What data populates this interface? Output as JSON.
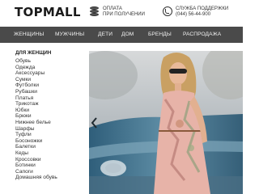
{
  "header": {
    "logo": "TOPMALL",
    "payment_line1": "ОПЛАТА",
    "payment_line2": "ПРИ ПОЛУЧЕНИИ",
    "support_line1": "СЛУЖБА ПОДДЕРЖКИ",
    "support_phone": "(044) 56-44-900"
  },
  "nav": {
    "items": [
      "ЖЕНЩИНЫ",
      "МУЖЧИНЫ",
      "ДЕТИ",
      "ДОМ",
      "БРЕНДЫ",
      "РАСПРОДАЖА"
    ]
  },
  "sidebar": {
    "title": "ДЛЯ ЖЕНЩИН",
    "items": [
      "Обувь",
      "Одежда",
      "Аксессуары",
      "Сумки",
      "Футболки",
      "Рубашки",
      "Платья",
      "Трикотаж",
      "Юбки",
      "Брюки",
      "Нижнее белье",
      "Шарфы",
      "Туфли",
      "Босоножки",
      "Балетки",
      "Кеды",
      "Кроссовки",
      "Ботинки",
      "Сапоги",
      "Домашняя обувь"
    ]
  },
  "icons": {
    "payment": "coins-icon",
    "support": "phone-icon",
    "slider_prev": "chevron-left-icon"
  },
  "colors": {
    "nav_bg": "#4a4a4a",
    "nav_text": "#f2f2f2"
  }
}
